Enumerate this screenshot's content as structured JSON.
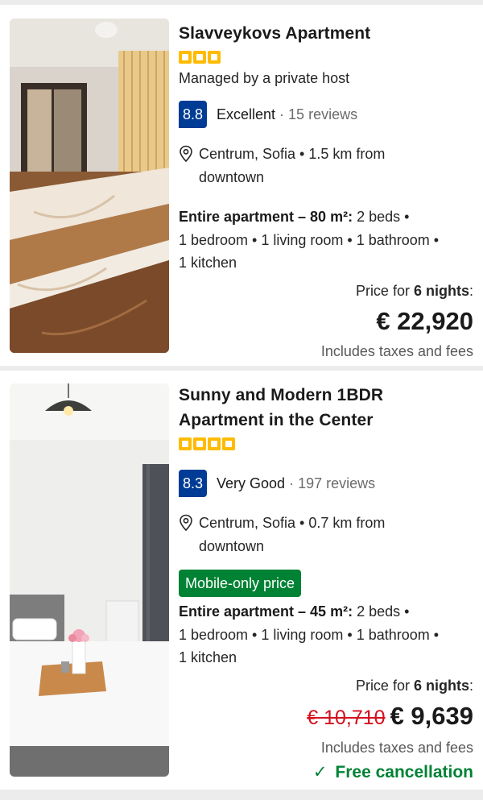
{
  "listings": [
    {
      "title": "Slavveykovs Apartment",
      "star_count": 3,
      "host": "Managed by a private host",
      "score": "8.8",
      "score_word": "Excellent",
      "separator": "·",
      "reviews": "15 reviews",
      "location_line1": "Centrum, Sofia • 1.5 km from",
      "location_line2": "downtown",
      "unit_bold": "Entire apartment – 80 m²:",
      "unit_line1_rest": " 2 beds •",
      "unit_line2": "1 bedroom • 1 living room • 1 bathroom •",
      "unit_line3": "1 kitchen",
      "price_for_prefix": "Price for ",
      "nights": "6 nights",
      "price_for_suffix": ":",
      "price": "€ 22,920",
      "taxes": "Includes taxes and fees"
    },
    {
      "title_line1": "Sunny and Modern 1BDR",
      "title_line2": "Apartment in the Center",
      "star_count": 4,
      "score": "8.3",
      "score_word": "Very Good",
      "separator": "·",
      "reviews": "197 reviews",
      "location_line1": "Centrum, Sofia • 0.7 km from",
      "location_line2": "downtown",
      "mobile_badge": "Mobile-only price",
      "unit_bold": "Entire apartment – 45 m²:",
      "unit_line1_rest": " 2 beds •",
      "unit_line2": "1 bedroom • 1 living room • 1 bathroom •",
      "unit_line3": "1 kitchen",
      "price_for_prefix": "Price for ",
      "nights": "6 nights",
      "price_for_suffix": ":",
      "old_price": "€ 10,710",
      "price": "€ 9,639",
      "taxes": "Includes taxes and fees",
      "free_cancellation": "Free cancellation"
    }
  ],
  "colors": {
    "score_bg": "#003b95",
    "stars": "#febb02",
    "green": "#008234",
    "strike_red": "#d4111e"
  },
  "icons": {
    "location": "map-pin-icon",
    "check": "check-icon",
    "star": "star-square-icon"
  }
}
